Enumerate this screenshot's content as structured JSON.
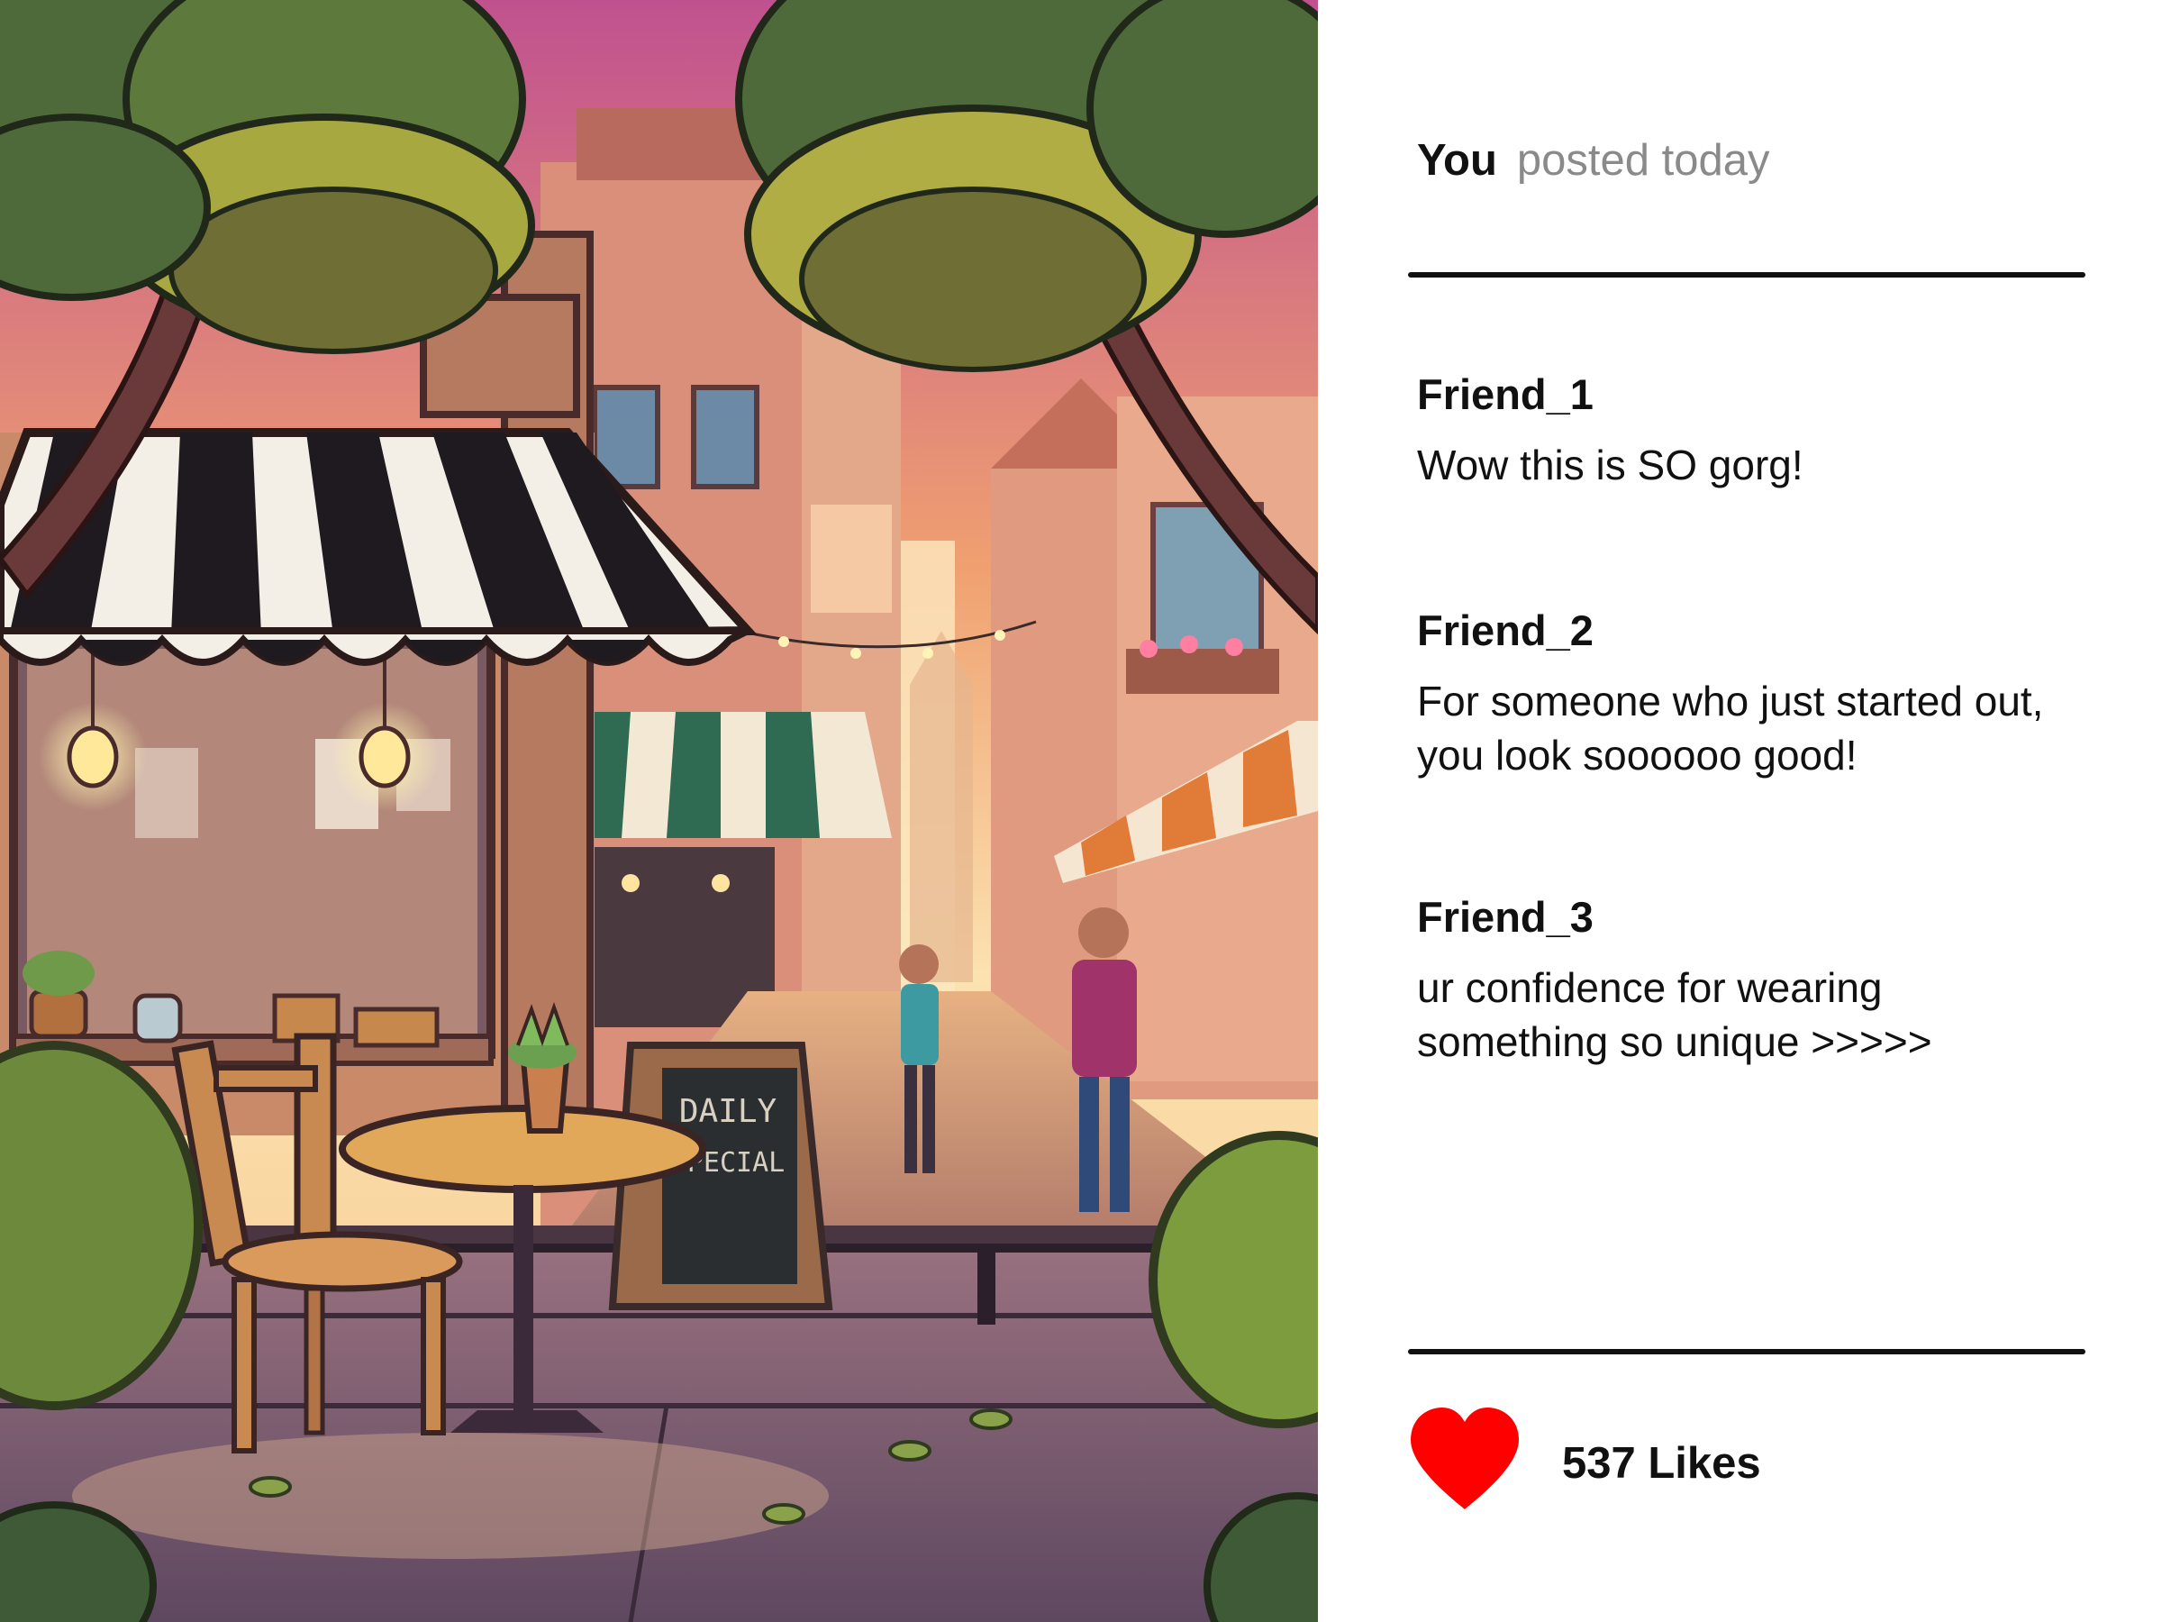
{
  "post": {
    "author": "You",
    "timestamp": "posted today",
    "image_subject": "illustrated street cafe scene"
  },
  "scene_sign": {
    "line1": "DAILY",
    "line2": "SPECIAL"
  },
  "comments": [
    {
      "user": "Friend_1",
      "text": "Wow this is SO gorg!"
    },
    {
      "user": "Friend_2",
      "text": "For someone who just started out, you look soooooo good!"
    },
    {
      "user": "Friend_3",
      "text": "ur confidence for wearing something so unique >>>>>"
    }
  ],
  "likes": {
    "label": "537 Likes",
    "icon": "heart-icon",
    "color": "#ff0000"
  },
  "colors": {
    "divider": "#111111",
    "timestamp": "#8a8a8a",
    "heart": "#ff0000"
  }
}
